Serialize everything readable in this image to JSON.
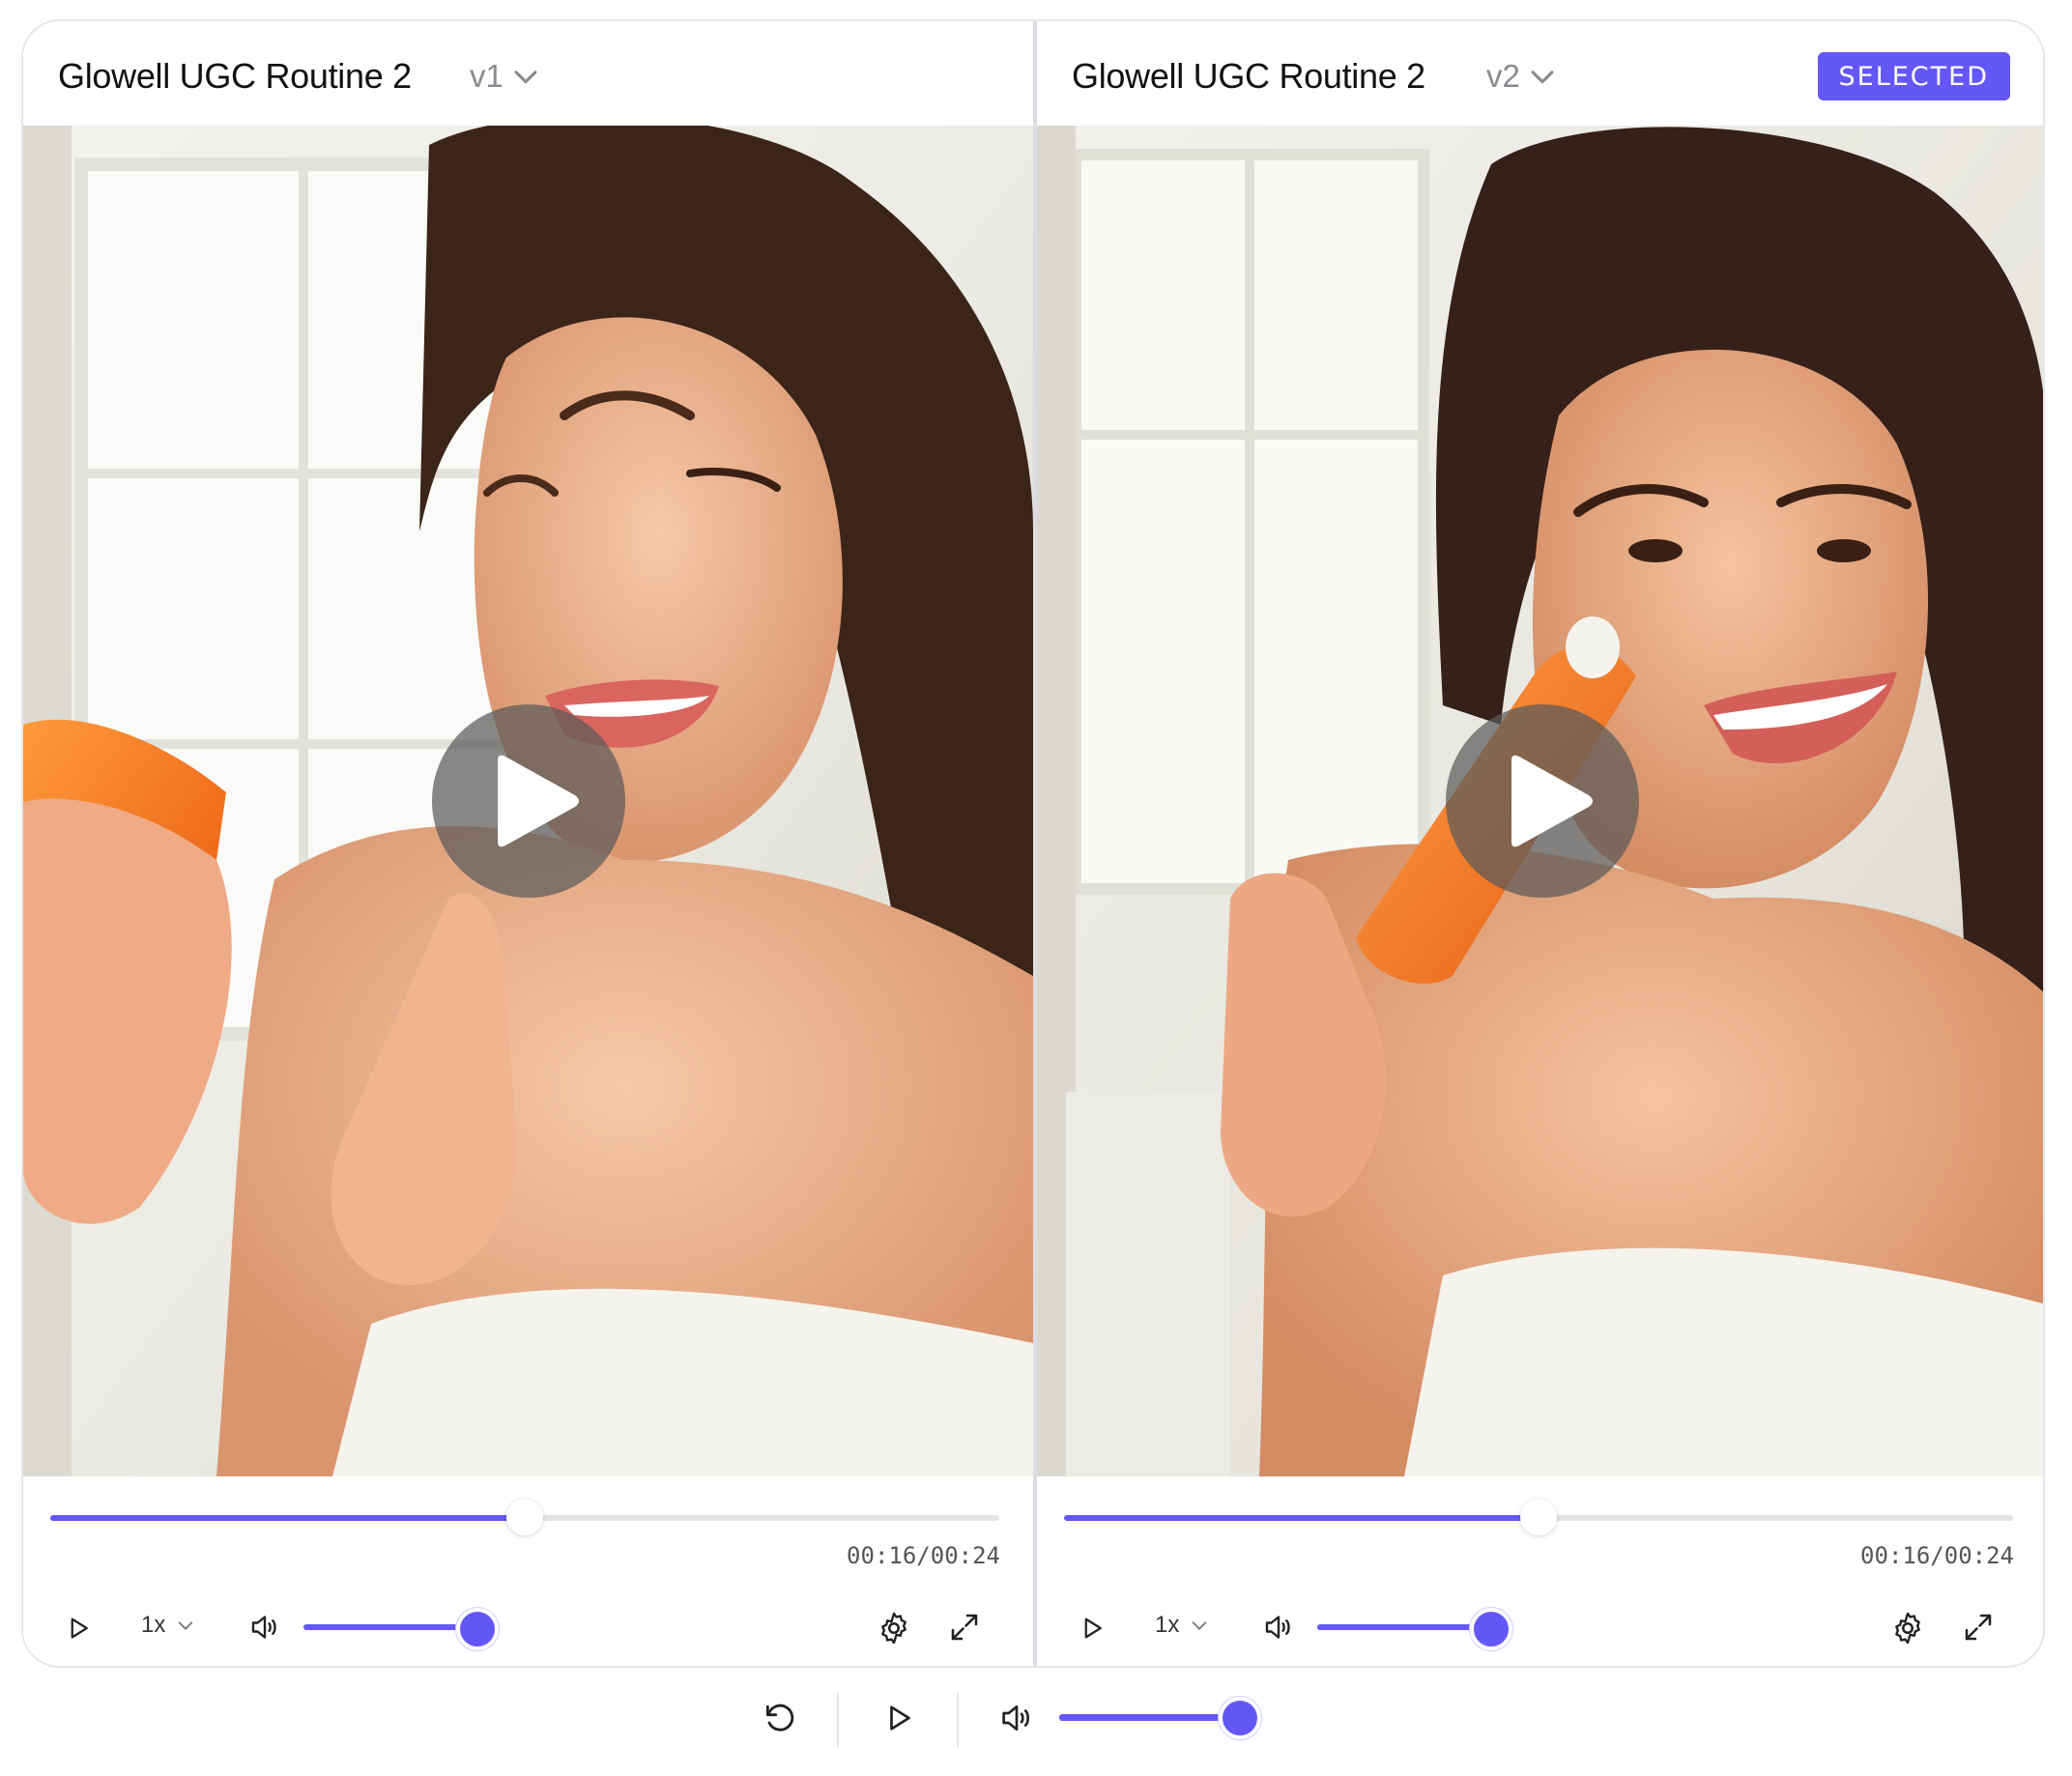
{
  "accent_color": "#6358f5",
  "panels": [
    {
      "title": "Glowell UGC Routine 2",
      "version": "v1",
      "selected": false,
      "progress": 0.5,
      "time": "00:16/00:24",
      "speed": "1x",
      "volume": 0.85
    },
    {
      "title": "Glowell UGC Routine 2",
      "version": "v2",
      "selected": true,
      "badge": "SELECTED",
      "progress": 0.5,
      "time": "00:16/00:24",
      "speed": "1x",
      "volume": 0.85
    }
  ],
  "global_controls": {
    "icons": [
      "replay-icon",
      "play-icon",
      "volume-icon"
    ],
    "volume": 0.85
  }
}
